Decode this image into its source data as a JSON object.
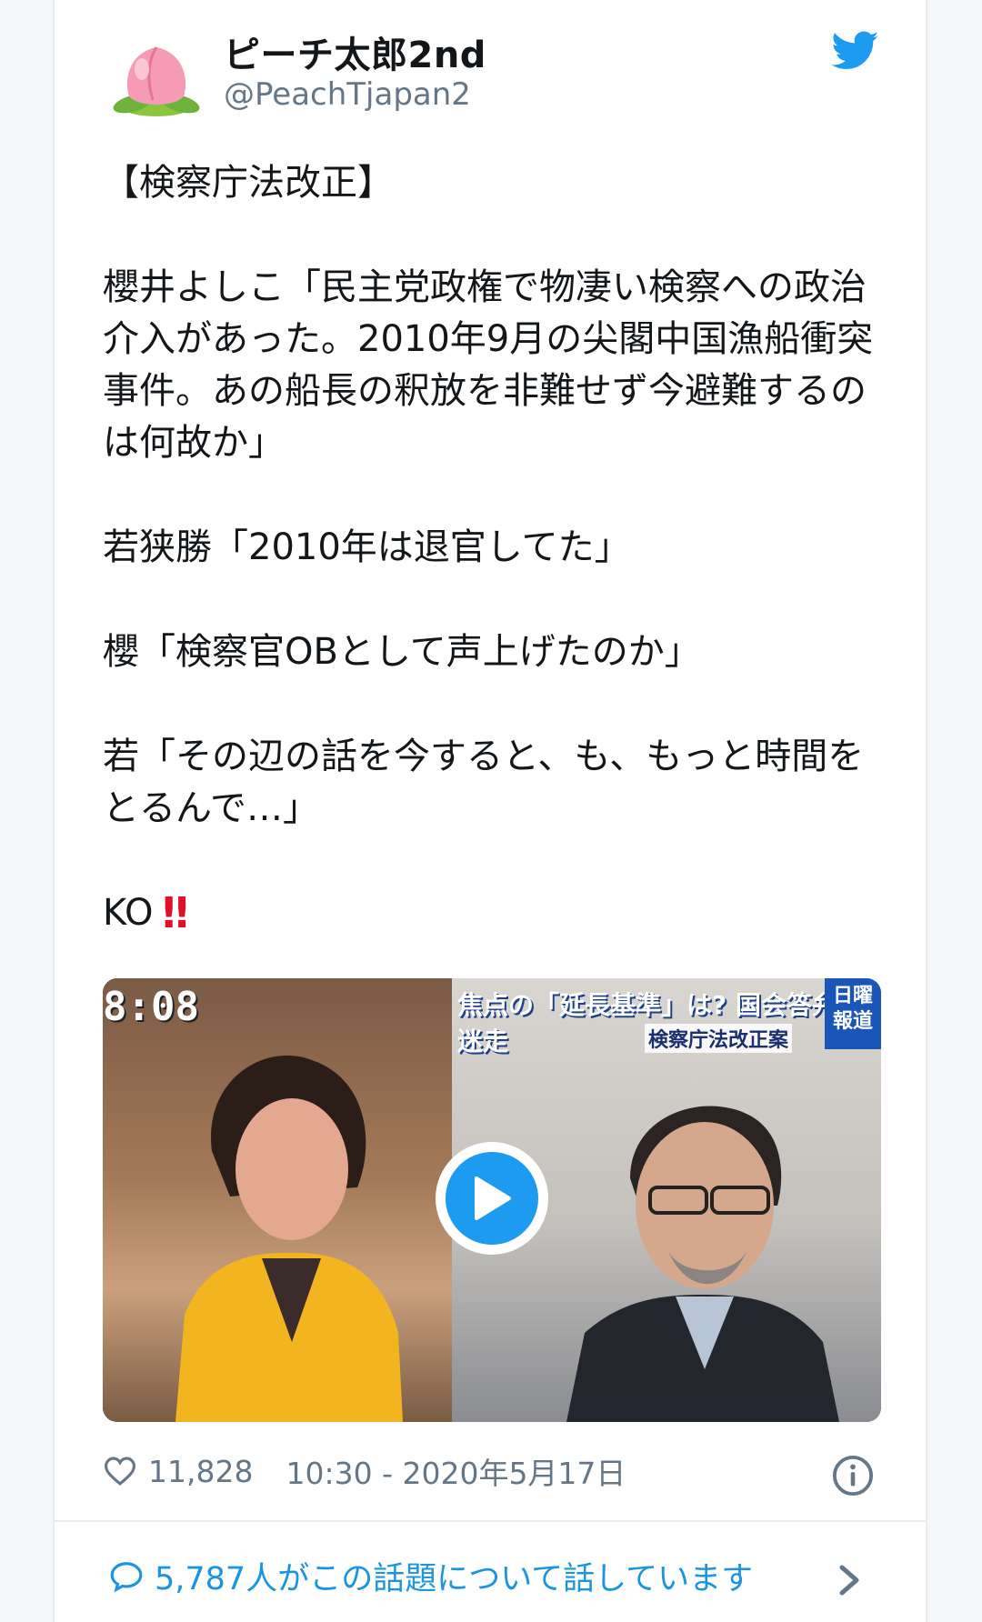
{
  "tweet": {
    "display_name": "ピーチ太郎2nd",
    "handle": "@PeachTjapan2",
    "paragraphs": [
      "【検察庁法改正】",
      "櫻井よしこ「民主党政権で物凄い検察への政治介入があった。2010年9月の尖閣中国漁船衝突事件。あの船長の釈放を非難せず今避難するのは何故か」",
      "若狭勝「2010年は退官してた」",
      "櫻「検察官OBとして声上げたのか」",
      "若「その辺の話を今すると、も、もっと時間をとるんで…」"
    ],
    "ko_text": "KO",
    "ko_emoji": "‼"
  },
  "media": {
    "clock": "8:08",
    "headline": "焦点の「延長基準」は? 国会答弁は迷走",
    "subheadline": "検察庁法改正案",
    "logo_line1": "日曜",
    "logo_line2": "報道"
  },
  "footer": {
    "likes": "11,828",
    "timestamp": "10:30 - 2020年5月17日",
    "conversation": "5,787人がこの話題について話しています"
  },
  "colors": {
    "accent": "#1d9bf0",
    "link": "#1b95e0",
    "muted": "#657786",
    "exclamation": "#e0102a"
  },
  "icons": [
    "peach-avatar-icon",
    "twitter-bird-icon",
    "play-icon",
    "heart-icon",
    "info-icon",
    "speech-bubble-icon",
    "chevron-right-icon"
  ]
}
